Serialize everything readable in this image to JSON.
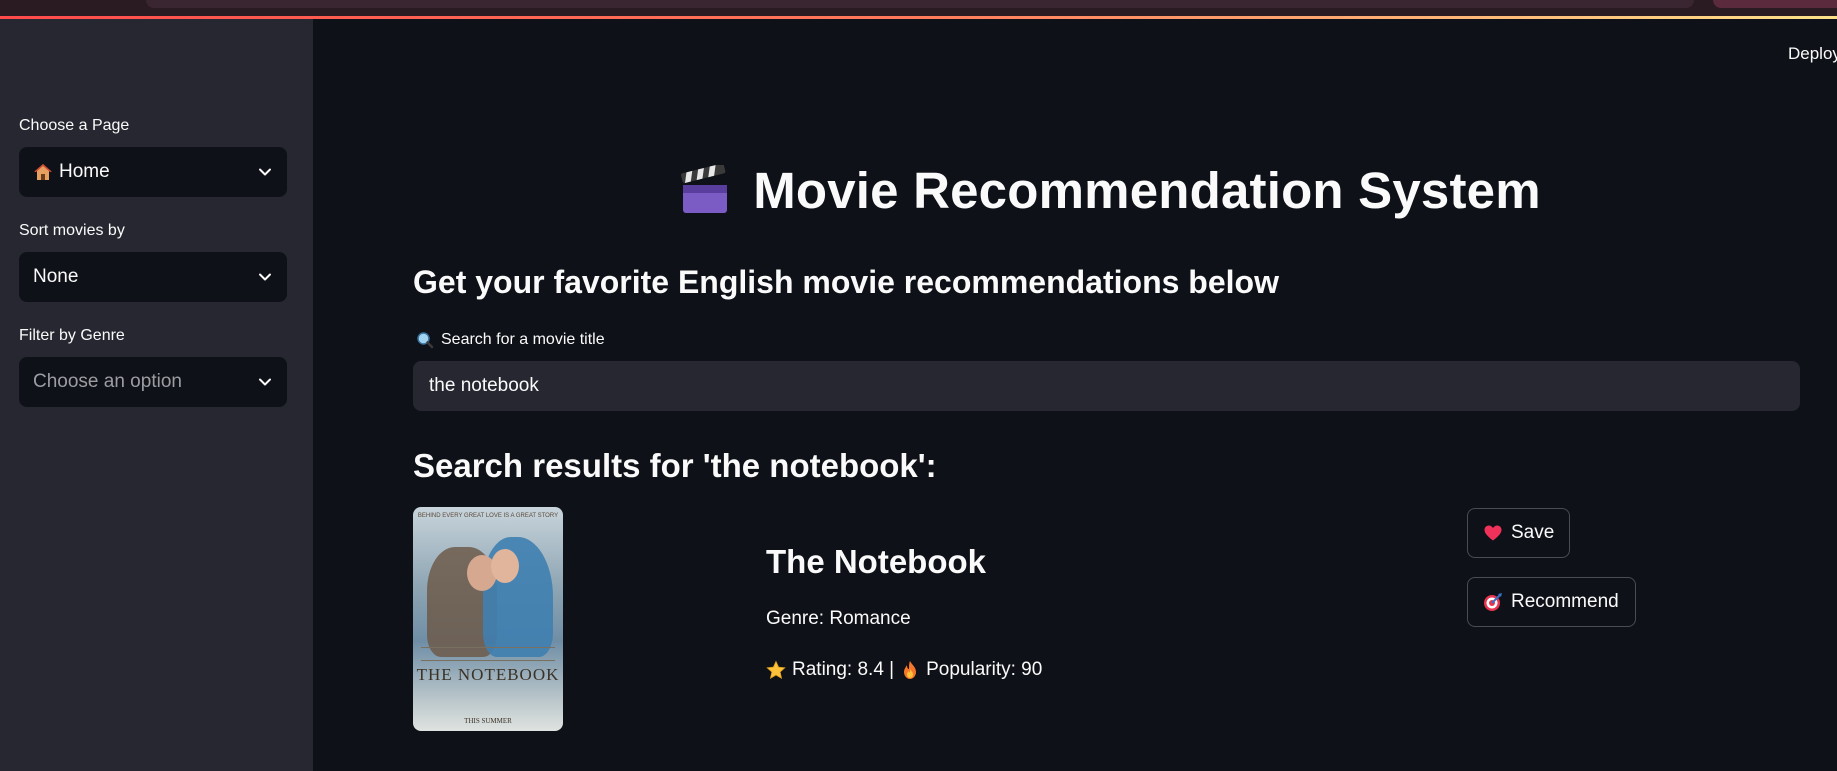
{
  "sidebar": {
    "page_label": "Choose a Page",
    "page_value": "Home",
    "sort_label": "Sort movies by",
    "sort_value": "None",
    "genre_label": "Filter by Genre",
    "genre_placeholder": "Choose an option"
  },
  "header": {
    "deploy_label": "Deploy"
  },
  "main": {
    "title": "Movie Recommendation System",
    "subtitle": "Get your favorite English movie recommendations below",
    "search_label": "Search for a movie title",
    "search_value": "the notebook",
    "results_heading": "Search results for 'the notebook':"
  },
  "result": {
    "title": "The Notebook",
    "genre": "Genre: Romance",
    "rating": "Rating: 8.4 |",
    "popularity": "Popularity: 90",
    "poster_title": "THE NOTEBOOK",
    "poster_tagline": "BEHIND EVERY GREAT LOVE IS A GREAT STORY",
    "poster_bottom": "THIS SUMMER",
    "save_label": "Save",
    "recommend_label": "Recommend"
  },
  "icons": {
    "page_icon": "house-icon",
    "title_icon": "clapperboard-icon",
    "search_icon": "magnifier-icon",
    "rating_icon": "star-icon",
    "popularity_icon": "fire-icon",
    "save_icon": "heart-icon",
    "recommend_icon": "target-icon"
  },
  "colors": {
    "background": "#0e1117",
    "sidebar": "#262730",
    "input": "#262730",
    "accent": "#ff4b4b"
  }
}
